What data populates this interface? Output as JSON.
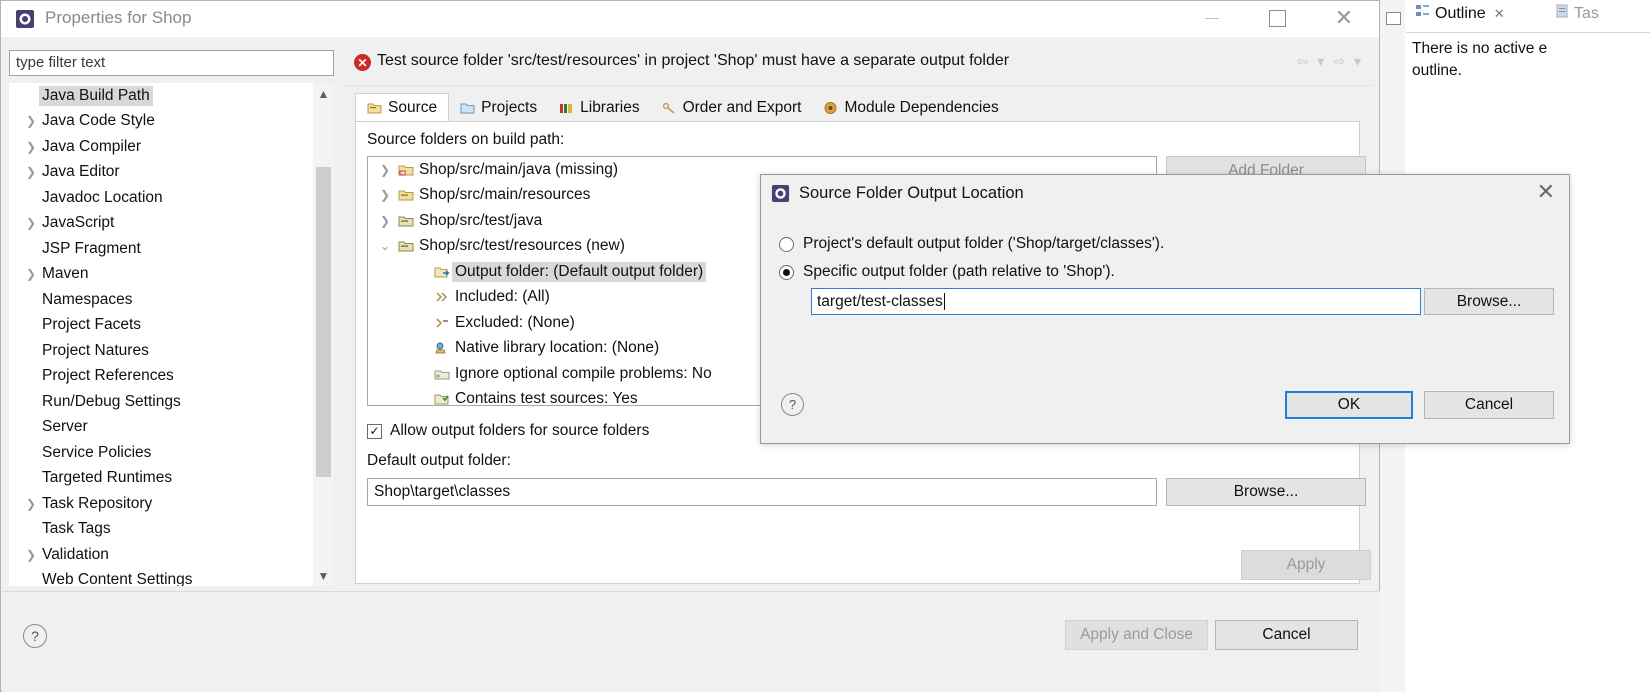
{
  "window": {
    "title": "Properties for Shop",
    "icon": "eclipse-properties-icon",
    "controls": {
      "minimize": "minimize-icon",
      "maximize": "maximize-icon",
      "close": "close-icon"
    }
  },
  "filter": {
    "placeholder": "type filter text",
    "value": "type filter text"
  },
  "sidebar": {
    "items": [
      {
        "label": "Java Build Path",
        "expandable": false,
        "selected": true
      },
      {
        "label": "Java Code Style",
        "expandable": true,
        "selected": false
      },
      {
        "label": "Java Compiler",
        "expandable": true,
        "selected": false
      },
      {
        "label": "Java Editor",
        "expandable": true,
        "selected": false
      },
      {
        "label": "Javadoc Location",
        "expandable": false,
        "selected": false
      },
      {
        "label": "JavaScript",
        "expandable": true,
        "selected": false
      },
      {
        "label": "JSP Fragment",
        "expandable": false,
        "selected": false
      },
      {
        "label": "Maven",
        "expandable": true,
        "selected": false
      },
      {
        "label": "Namespaces",
        "expandable": false,
        "selected": false
      },
      {
        "label": "Project Facets",
        "expandable": false,
        "selected": false
      },
      {
        "label": "Project Natures",
        "expandable": false,
        "selected": false
      },
      {
        "label": "Project References",
        "expandable": false,
        "selected": false
      },
      {
        "label": "Run/Debug Settings",
        "expandable": false,
        "selected": false
      },
      {
        "label": "Server",
        "expandable": false,
        "selected": false
      },
      {
        "label": "Service Policies",
        "expandable": false,
        "selected": false
      },
      {
        "label": "Targeted Runtimes",
        "expandable": false,
        "selected": false
      },
      {
        "label": "Task Repository",
        "expandable": true,
        "selected": false
      },
      {
        "label": "Task Tags",
        "expandable": false,
        "selected": false
      },
      {
        "label": "Validation",
        "expandable": true,
        "selected": false
      },
      {
        "label": "Web Content Settings",
        "expandable": false,
        "selected": false
      }
    ],
    "scroll_up_icon": "chevron-up-icon",
    "scroll_down_icon": "chevron-down-icon"
  },
  "error_banner": {
    "icon": "error-icon",
    "message": "Test source folder 'src/test/resources' in project 'Shop' must have a separate output folder",
    "nav": [
      {
        "icon": "back-arrow-icon"
      },
      {
        "icon": "dropdown-triangle-icon"
      },
      {
        "icon": "forward-arrow-icon"
      },
      {
        "icon": "dropdown-triangle-icon"
      }
    ]
  },
  "tabs": [
    {
      "label": "Source",
      "icon": "source-folder-icon",
      "active": true
    },
    {
      "label": "Projects",
      "icon": "projects-icon",
      "active": false
    },
    {
      "label": "Libraries",
      "icon": "libraries-icon",
      "active": false
    },
    {
      "label": "Order and Export",
      "icon": "order-export-icon",
      "active": false
    },
    {
      "label": "Module Dependencies",
      "icon": "module-dependencies-icon",
      "active": false
    }
  ],
  "source_panel": {
    "label": "Source folders on build path:",
    "add_folder_label": "Add Folder",
    "tree": [
      {
        "label": "Shop/src/main/java (missing)",
        "arrow": "collapsed",
        "icon": "source-folder-missing-icon",
        "indent": 0,
        "selected": false
      },
      {
        "label": "Shop/src/main/resources",
        "arrow": "collapsed",
        "icon": "source-folder-icon",
        "indent": 0,
        "selected": false
      },
      {
        "label": "Shop/src/test/java",
        "arrow": "collapsed",
        "icon": "test-source-folder-icon",
        "indent": 0,
        "selected": false
      },
      {
        "label": "Shop/src/test/resources (new)",
        "arrow": "expanded",
        "icon": "test-source-folder-icon",
        "indent": 0,
        "selected": false
      },
      {
        "label": "Output folder: (Default output folder)",
        "arrow": "none",
        "icon": "output-folder-icon",
        "indent": 1,
        "selected": true
      },
      {
        "label": "Included: (All)",
        "arrow": "none",
        "icon": "included-filter-icon",
        "indent": 1,
        "selected": false
      },
      {
        "label": "Excluded: (None)",
        "arrow": "none",
        "icon": "excluded-filter-icon",
        "indent": 1,
        "selected": false
      },
      {
        "label": "Native library location: (None)",
        "arrow": "none",
        "icon": "native-library-icon",
        "indent": 1,
        "selected": false
      },
      {
        "label": "Ignore optional compile problems: No",
        "arrow": "none",
        "icon": "compile-problems-icon",
        "indent": 1,
        "selected": false
      },
      {
        "label": "Contains test sources: Yes",
        "arrow": "none",
        "icon": "test-sources-icon",
        "indent": 1,
        "selected": false
      }
    ],
    "allow_output_checkbox": {
      "label": "Allow output folders for source folders",
      "checked": true
    },
    "default_output_label": "Default output folder:",
    "default_output_value": "Shop\\target\\classes",
    "browse_label": "Browse...",
    "apply_label": "Apply"
  },
  "footer": {
    "help_icon": "help-icon",
    "apply_and_close_label": "Apply and Close",
    "cancel_label": "Cancel"
  },
  "dialog": {
    "title": "Source Folder Output Location",
    "icon": "eclipse-dialog-icon",
    "close_icon": "close-icon",
    "radio_default": {
      "label": "Project's default output folder ('Shop/target/classes').",
      "selected": false
    },
    "radio_specific": {
      "label": "Specific output folder (path relative to 'Shop').",
      "selected": true
    },
    "path_value": "target/test-classes",
    "browse_label": "Browse...",
    "help_icon": "help-icon",
    "ok_label": "OK",
    "cancel_label": "Cancel"
  },
  "outline_view": {
    "tabs": [
      {
        "label": "Outline",
        "icon": "outline-icon",
        "active": true,
        "close_icon": "close-icon"
      },
      {
        "label": "Tas",
        "icon": "task-list-icon",
        "active": false
      }
    ],
    "empty_message_line1": "There is no active e",
    "empty_message_line2": "outline.",
    "minimize_icon": "minimize-view-icon"
  },
  "colors": {
    "error_red": "#cc2a2a",
    "focus_blue": "#1f7fd6",
    "selection_gray": "#d8d8d8",
    "window_bg": "#f0f0f0"
  }
}
